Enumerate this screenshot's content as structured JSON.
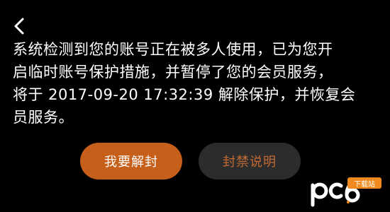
{
  "navigation": {
    "back_icon": "chevron-left-icon"
  },
  "message": {
    "text": "系统检测到您的账号正在被多人使用，已为您开\n启临时账号保护措施，并暂停了您的会员服务，\n将于 2017-09-20 17:32:39 解除保护，并恢复会\n员服务。"
  },
  "actions": {
    "unblock_label": "我要解封",
    "info_label": "封禁说明"
  },
  "watermark": {
    "logo_text": "pc6",
    "badge_text": "下载站"
  },
  "colors": {
    "background": "#000000",
    "primary_button": "#c55f1a",
    "secondary_button": "#2c2c2c",
    "secondary_text": "#c16a34",
    "watermark_accent": "#f08a1e"
  }
}
